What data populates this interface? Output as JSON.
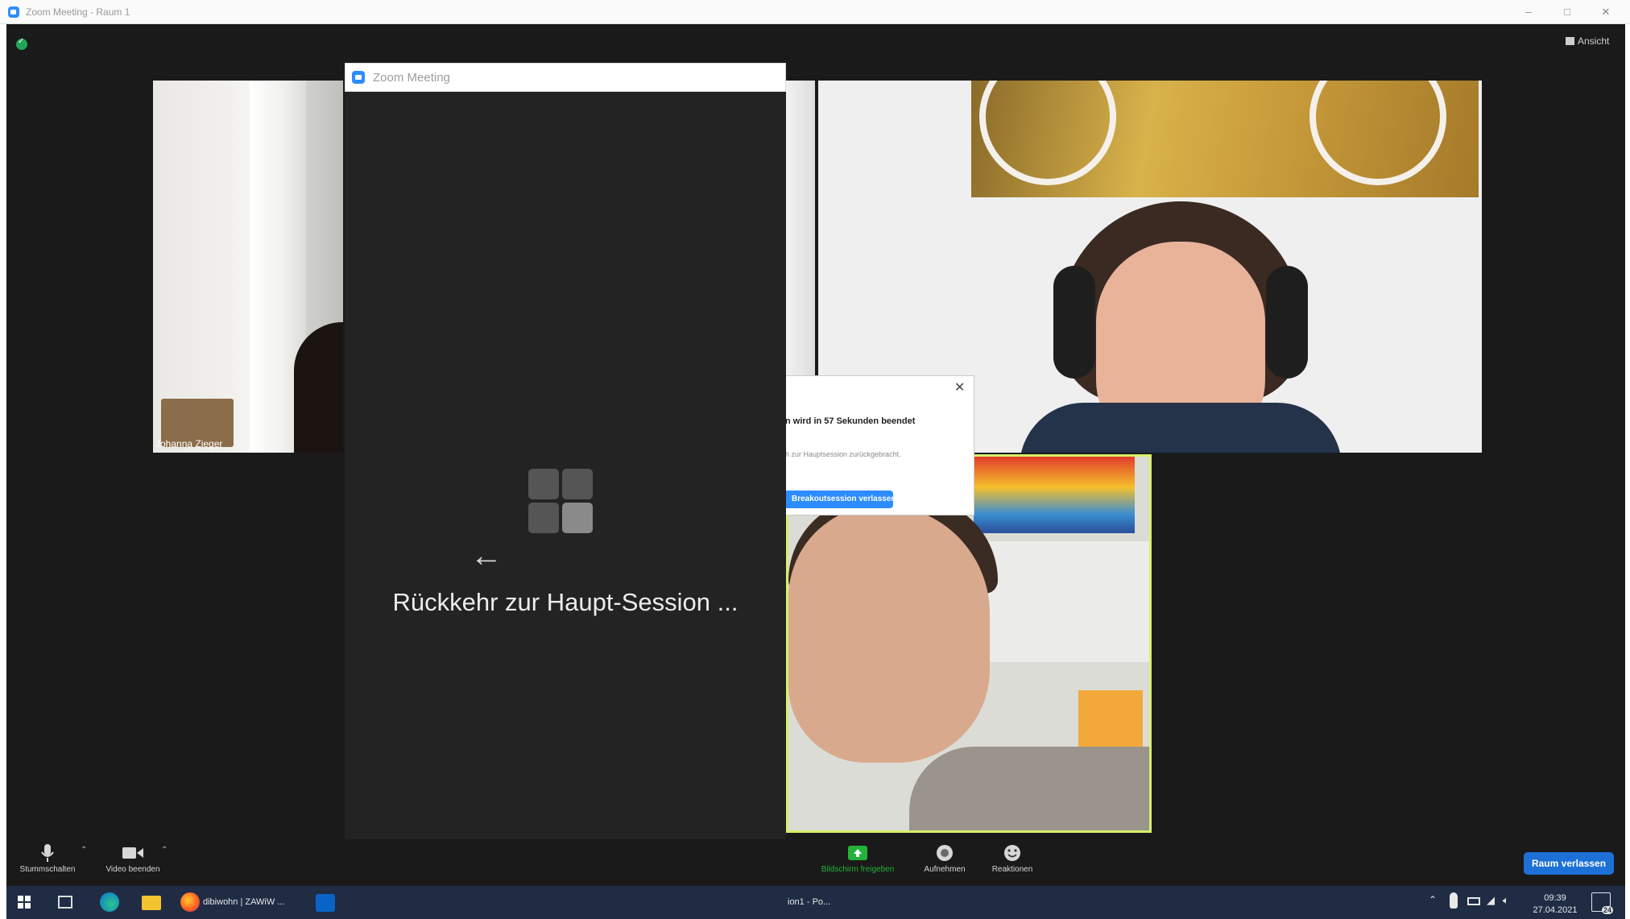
{
  "window": {
    "title": "Zoom Meeting - Raum 1",
    "view_label": "Ansicht"
  },
  "participants": [
    {
      "name": "Johanna Zieger"
    }
  ],
  "overlay": {
    "title": "Zoom Meeting",
    "message": "Rückkehr zur Haupt-Session ..."
  },
  "notification": {
    "message": "n wird in 57 Sekunden beendet",
    "sub": "h zur Hauptsession zurückgebracht.",
    "button": "Breakoutsession verlassen"
  },
  "toolbar": {
    "mute": "Stummschalten",
    "video": "Video beenden",
    "share": "Bildschirm freigeben",
    "record": "Aufnehmen",
    "reactions": "Reaktionen",
    "leave": "Raum verlassen"
  },
  "taskbar": {
    "items": [
      "dibiwohn | ZAWiW ...",
      "ion1 - Po..."
    ],
    "time": "09:39",
    "date": "27.04.2021",
    "notifications": "24"
  },
  "colors": {
    "accent": "#2d8cff",
    "active_speaker_border": "#d7f06a",
    "share_green": "#23b33a"
  }
}
